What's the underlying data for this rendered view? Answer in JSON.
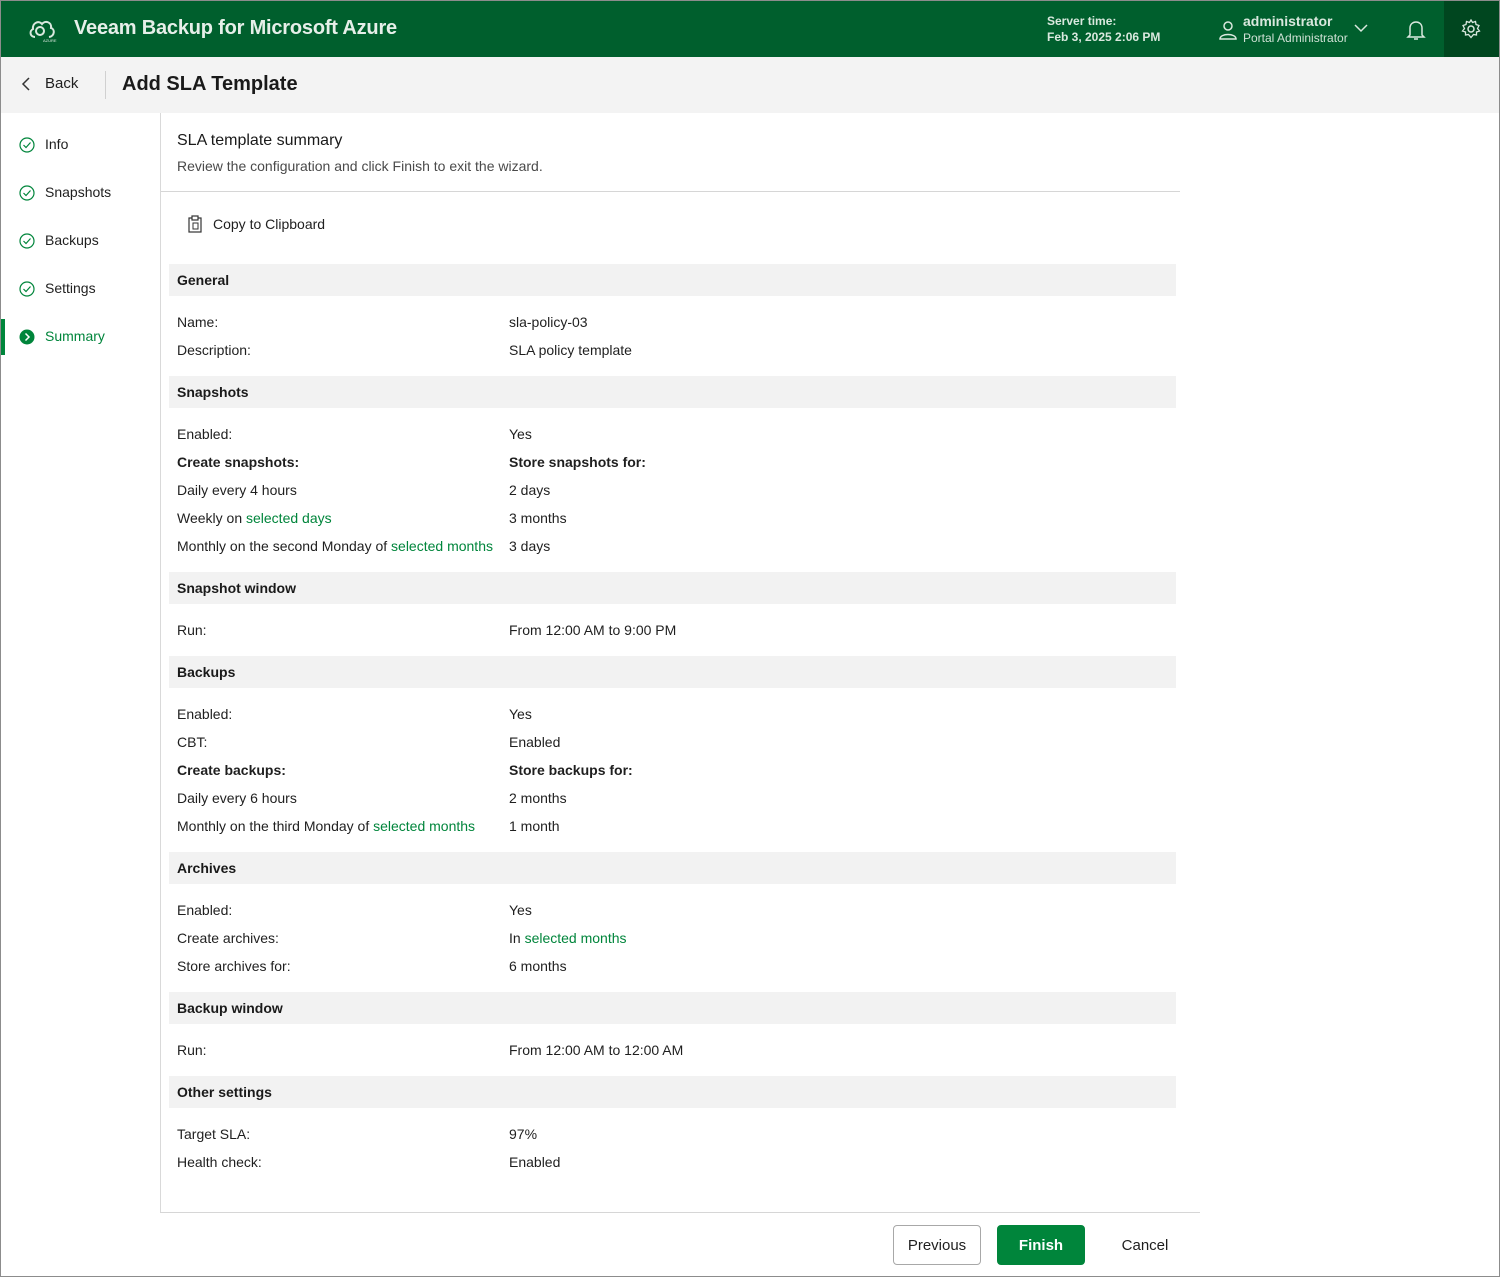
{
  "app": {
    "title": "Veeam Backup for Microsoft Azure",
    "logo_sub": "AZURE",
    "server_time_label": "Server time:",
    "server_time_value": "Feb 3, 2025 2:06 PM",
    "user_name": "administrator",
    "user_role": "Portal Administrator"
  },
  "header": {
    "back_label": "Back",
    "title": "Add SLA Template"
  },
  "sidebar": {
    "items": [
      {
        "label": "Info",
        "state": "done"
      },
      {
        "label": "Snapshots",
        "state": "done"
      },
      {
        "label": "Backups",
        "state": "done"
      },
      {
        "label": "Settings",
        "state": "done"
      },
      {
        "label": "Summary",
        "state": "active"
      }
    ]
  },
  "summary": {
    "title": "SLA template summary",
    "subtitle": "Review the configuration and click Finish to exit the wizard.",
    "copy_label": "Copy to Clipboard",
    "general": {
      "heading": "General",
      "name_label": "Name:",
      "name_value": "sla-policy-03",
      "desc_label": "Description:",
      "desc_value": "SLA policy template"
    },
    "snapshots": {
      "heading": "Snapshots",
      "enabled_label": "Enabled:",
      "enabled_value": "Yes",
      "create_label": "Create snapshots:",
      "store_label": "Store snapshots for:",
      "daily_label": "Daily every 4 hours",
      "daily_value": "2 days",
      "weekly_prefix": "Weekly on ",
      "weekly_link": "selected days",
      "weekly_value": "3 months",
      "monthly_prefix": "Monthly on the second Monday of ",
      "monthly_link": "selected months",
      "monthly_value": "3 days"
    },
    "snapshot_window": {
      "heading": "Snapshot window",
      "run_label": "Run:",
      "run_value": "From 12:00 AM to 9:00 PM"
    },
    "backups": {
      "heading": "Backups",
      "enabled_label": "Enabled:",
      "enabled_value": "Yes",
      "cbt_label": "CBT:",
      "cbt_value": "Enabled",
      "create_label": "Create backups:",
      "store_label": "Store backups for:",
      "daily_label": "Daily every 6 hours",
      "daily_value": "2 months",
      "monthly_prefix": "Monthly on the third Monday of ",
      "monthly_link": "selected months",
      "monthly_value": "1 month"
    },
    "archives": {
      "heading": "Archives",
      "enabled_label": "Enabled:",
      "enabled_value": "Yes",
      "create_label": "Create archives:",
      "create_prefix": "In ",
      "create_link": "selected months",
      "store_label": "Store archives for:",
      "store_value": "6 months"
    },
    "backup_window": {
      "heading": "Backup window",
      "run_label": "Run:",
      "run_value": "From 12:00 AM to 12:00 AM"
    },
    "other": {
      "heading": "Other settings",
      "sla_label": "Target SLA:",
      "sla_value": "97%",
      "health_label": "Health check:",
      "health_value": "Enabled"
    }
  },
  "footer": {
    "previous_label": "Previous",
    "finish_label": "Finish",
    "cancel_label": "Cancel"
  },
  "colors": {
    "brand": "#005f2d",
    "accent": "#00853b"
  }
}
